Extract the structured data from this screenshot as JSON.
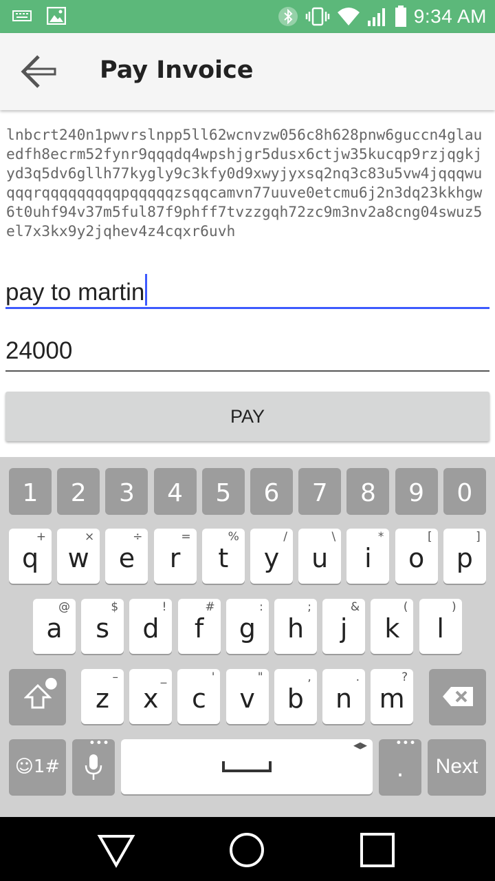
{
  "status_bar": {
    "time": "9:34 AM",
    "icons": [
      "keyboard-icon",
      "image-icon",
      "bluetooth-icon",
      "vibrate-icon",
      "wifi-icon",
      "signal-icon",
      "battery-icon"
    ]
  },
  "app_bar": {
    "back_icon": "arrow-left-icon",
    "title": "Pay Invoice"
  },
  "invoice": {
    "text": "lnbcrt240n1pwvrslnpp5ll62wcnvzw056c8h628pnw6guccn4glauedfh8ecrm52fynr9qqqdq4wpshjgr5dusx6ctjw35kucqp9rzjqgkjyd3q5dv6gllh77kygly9c3kfy0d9xwyjyxsq2nq3c83u5vw4jqqqwuqqqrqqqqqqqqqpqqqqqzsqqcamvn77uuve0etcmu6j2n3dq23kkhgw6t0uhf94v37m5ful87f9phff7tvzzgqh72zc9m3nv2a8cng04swuz5el7x3kx9y2jqhev4z4cqxr6uvh"
  },
  "form": {
    "description_value": "pay to martin",
    "amount_value": "24000",
    "pay_label": "PAY"
  },
  "keyboard": {
    "numbers": [
      "1",
      "2",
      "3",
      "4",
      "5",
      "6",
      "7",
      "8",
      "9",
      "0"
    ],
    "row1": [
      {
        "k": "q",
        "h": "+"
      },
      {
        "k": "w",
        "h": "×"
      },
      {
        "k": "e",
        "h": "÷"
      },
      {
        "k": "r",
        "h": "="
      },
      {
        "k": "t",
        "h": "%"
      },
      {
        "k": "y",
        "h": "/"
      },
      {
        "k": "u",
        "h": "\\"
      },
      {
        "k": "i",
        "h": "*"
      },
      {
        "k": "o",
        "h": "["
      },
      {
        "k": "p",
        "h": "]"
      }
    ],
    "row2": [
      {
        "k": "a",
        "h": "@"
      },
      {
        "k": "s",
        "h": "$"
      },
      {
        "k": "d",
        "h": "!"
      },
      {
        "k": "f",
        "h": "#"
      },
      {
        "k": "g",
        "h": ":"
      },
      {
        "k": "h",
        "h": ";"
      },
      {
        "k": "j",
        "h": "&"
      },
      {
        "k": "k",
        "h": "("
      },
      {
        "k": "l",
        "h": ")"
      }
    ],
    "row3": [
      {
        "k": "z",
        "h": "–"
      },
      {
        "k": "x",
        "h": "_"
      },
      {
        "k": "c",
        "h": "'"
      },
      {
        "k": "v",
        "h": "\""
      },
      {
        "k": "b",
        "h": ","
      },
      {
        "k": "n",
        "h": "."
      },
      {
        "k": "m",
        "h": "?"
      }
    ],
    "symbols_label": "☺1#",
    "period_label": ".",
    "next_label": "Next",
    "shift_icon": "shift-icon",
    "backspace_icon": "backspace-icon",
    "mic_icon": "microphone-icon",
    "space_icon": "space-bar-icon"
  },
  "nav_bar": {
    "icons": [
      "back-triangle-icon",
      "home-circle-icon",
      "recents-square-icon"
    ]
  }
}
